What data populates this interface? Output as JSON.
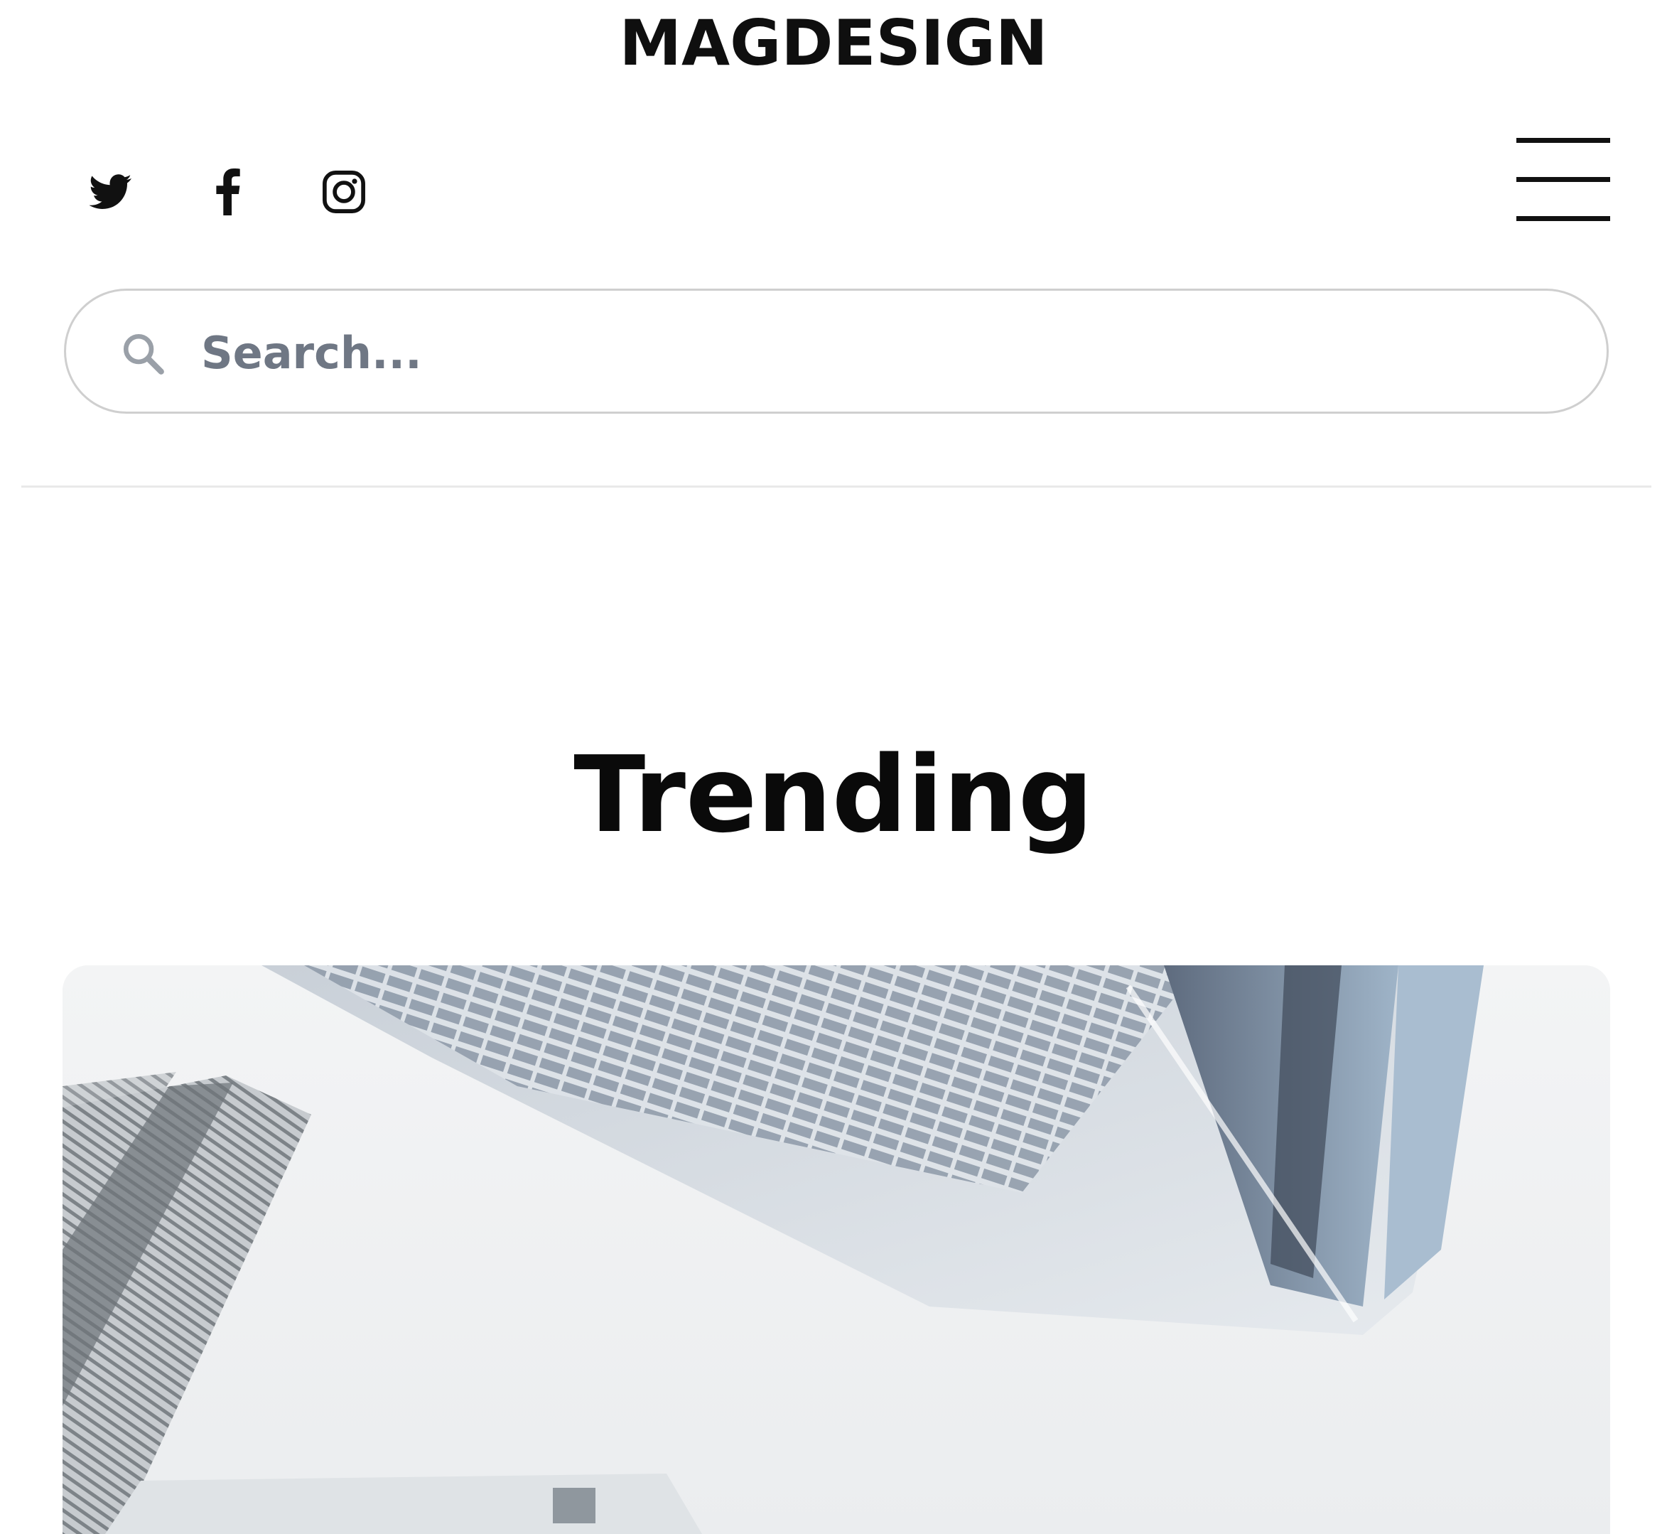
{
  "header": {
    "logo": "MAGDESIGN",
    "social": [
      {
        "name": "twitter-icon"
      },
      {
        "name": "facebook-icon"
      },
      {
        "name": "instagram-icon"
      }
    ],
    "menu_icon": "hamburger-menu-icon"
  },
  "search": {
    "placeholder": "Search...",
    "value": "",
    "icon": "search-icon"
  },
  "section": {
    "title": "Trending"
  },
  "colors": {
    "text": "#111111",
    "placeholder": "#6f7784",
    "border": "#cfcfcf",
    "divider": "#e9e9e9"
  }
}
